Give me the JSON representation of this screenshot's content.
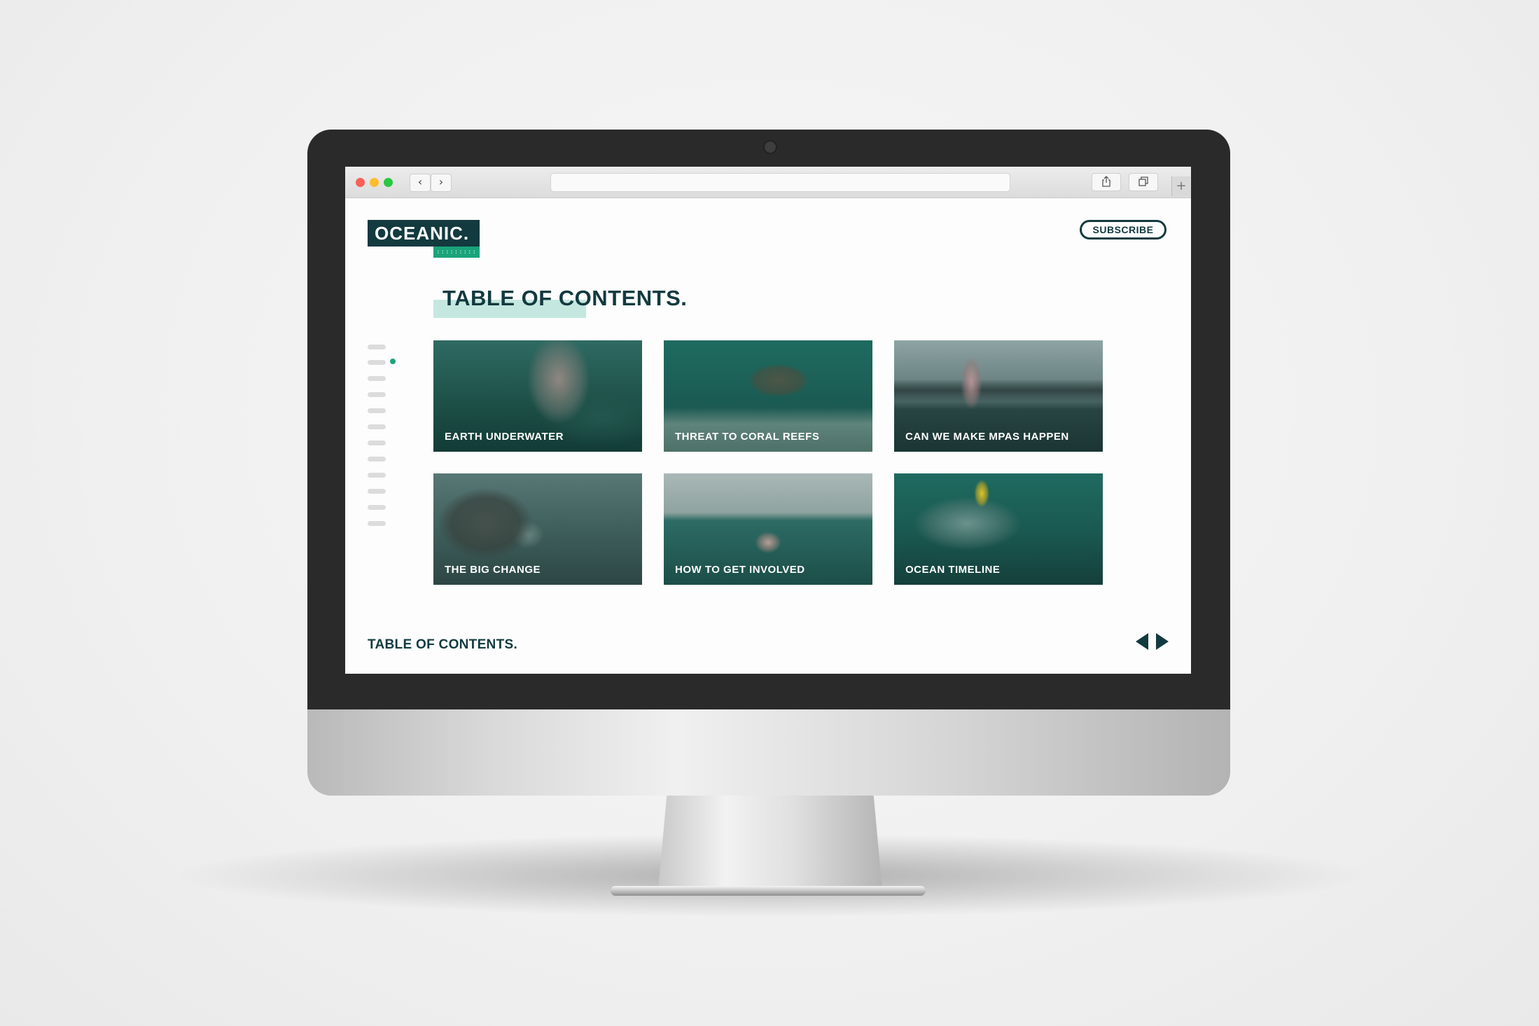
{
  "browser": {
    "window_controls": [
      "close",
      "minimize",
      "zoom"
    ],
    "back_icon": "chevron-left-icon",
    "forward_icon": "chevron-right-icon",
    "address_value": "",
    "share_icon": "share-icon",
    "tabs_icon": "tabs-overview-icon",
    "new_tab_symbol": "+"
  },
  "header": {
    "logo_text": "OCEANIC.",
    "subscribe_label": "SUBSCRIBE"
  },
  "main": {
    "title": "TABLE OF CONTENTS.",
    "cards": [
      {
        "label": "EARTH UNDERWATER",
        "image": "dolphin-underwater"
      },
      {
        "label": "THREAT TO CORAL REEFS",
        "image": "sea-turtle-coral"
      },
      {
        "label": "CAN WE MAKE MPAS HAPPEN",
        "image": "swimmer-arctic"
      },
      {
        "label": "THE BIG CHANGE",
        "image": "rock-arch-coast"
      },
      {
        "label": "HOW TO GET INVOLVED",
        "image": "swimmer-cliffs"
      },
      {
        "label": "OCEAN TIMELINE",
        "image": "turtle-headphones"
      }
    ]
  },
  "side_nav": {
    "item_count": 12,
    "active_index": 1
  },
  "footer": {
    "title": "TABLE OF CONTENTS.",
    "prev_icon": "triangle-left-icon",
    "next_icon": "triangle-right-icon"
  },
  "colors": {
    "brand_dark": "#123a3f",
    "brand_green": "#1aa37a",
    "highlight": "#c4e8df"
  }
}
